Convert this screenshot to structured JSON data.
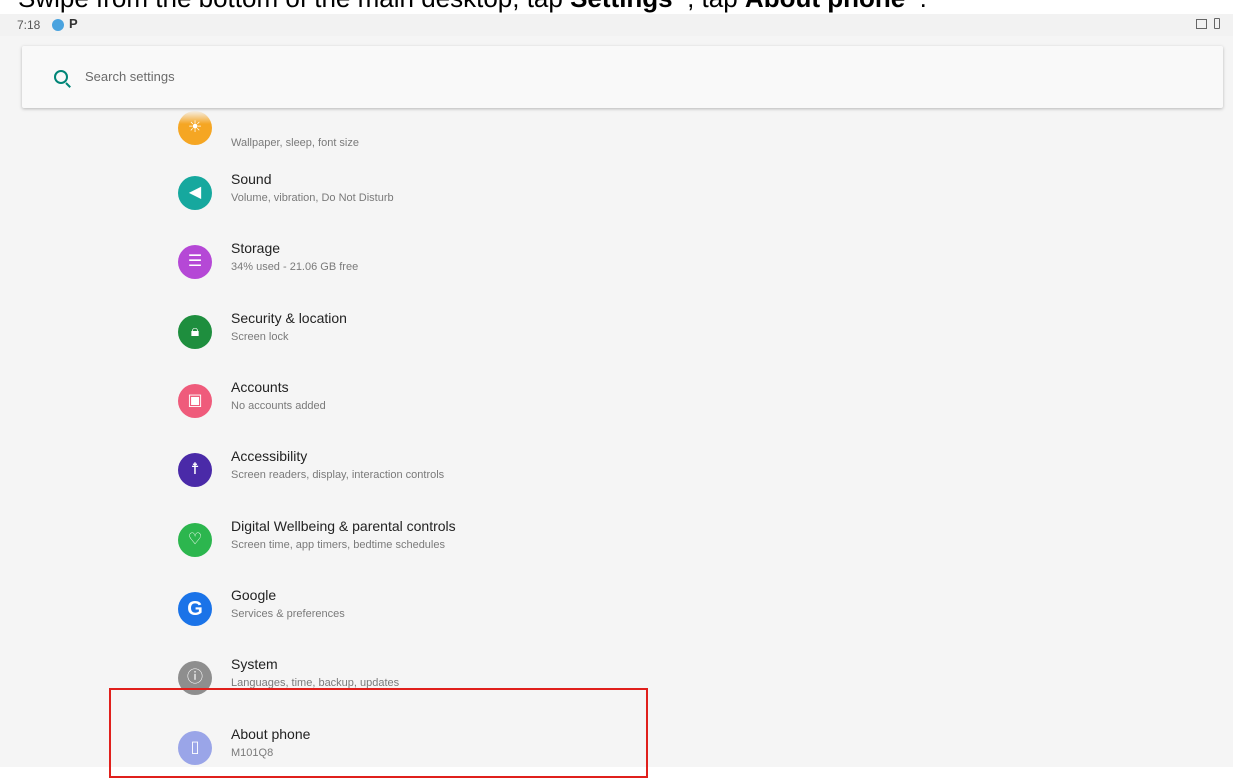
{
  "instruction": {
    "text_pre": "Swipe from the bottom of the main desktop, tap ",
    "settings": "Settings",
    "text_mid": "  , tap ",
    "about": "About phone",
    "text_post": "  ."
  },
  "statusbar": {
    "time": "7:18",
    "notification_icon": "P"
  },
  "search": {
    "placeholder": "Search settings"
  },
  "items": [
    {
      "title": "",
      "subtitle": "Wallpaper, sleep, font size",
      "color": "#f5a623",
      "icon": "display-icon"
    },
    {
      "title": "Sound",
      "subtitle": "Volume, vibration, Do Not Disturb",
      "color": "#16a89e",
      "icon": "volume-icon"
    },
    {
      "title": "Storage",
      "subtitle": "34% used - 21.06 GB free",
      "color": "#b548d6",
      "icon": "storage-icon"
    },
    {
      "title": "Security & location",
      "subtitle": "Screen lock",
      "color": "#1e8e3e",
      "icon": "lock-icon"
    },
    {
      "title": "Accounts",
      "subtitle": "No accounts added",
      "color": "#ef5b7b",
      "icon": "account-icon"
    },
    {
      "title": "Accessibility",
      "subtitle": "Screen readers, display, interaction controls",
      "color": "#4a2aa8",
      "icon": "accessibility-icon"
    },
    {
      "title": "Digital Wellbeing & parental controls",
      "subtitle": "Screen time, app timers, bedtime schedules",
      "color": "#2cb64e",
      "icon": "wellbeing-icon"
    },
    {
      "title": "Google",
      "subtitle": "Services & preferences",
      "color": "#1a73e8",
      "icon": "google-icon"
    },
    {
      "title": "System",
      "subtitle": "Languages, time, backup, updates",
      "color": "#8e8e8e",
      "icon": "info-icon"
    },
    {
      "title": "About phone",
      "subtitle": "M101Q8",
      "color": "#9aa5e8",
      "icon": "phone-icon"
    }
  ]
}
